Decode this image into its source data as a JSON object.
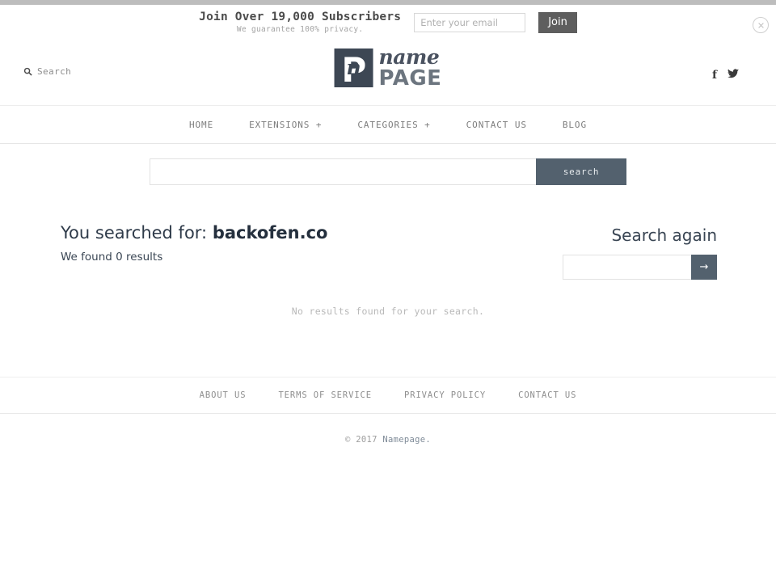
{
  "colors": {
    "accent_slate": "#53616e",
    "logo_dark": "#3d4754",
    "join_button": "#5e5e5e",
    "top_strip": "#bdbdbd",
    "heading_navy": "#2f3b4a",
    "muted_gray": "#b9b9b9"
  },
  "optin": {
    "title": "Join Over 19,000 Subscribers",
    "subtitle": "We guarantee 100% privacy.",
    "email_placeholder": "Enter your email",
    "email_value": "",
    "join_label": "Join",
    "close_icon": "close-circle-icon"
  },
  "header": {
    "search_label": "Search",
    "search_icon": "magnifier-icon",
    "logo": {
      "mark_letter": "P",
      "mark_script": "n",
      "word_top": "name",
      "word_bottom": "PAGE"
    },
    "socials": [
      {
        "name": "facebook",
        "icon": "facebook-icon",
        "glyph": "f"
      },
      {
        "name": "twitter",
        "icon": "twitter-bird-icon",
        "glyph": ""
      }
    ]
  },
  "mainnav": {
    "items": [
      {
        "label": "HOME"
      },
      {
        "label": "EXTENSIONS +"
      },
      {
        "label": "CATEGORIES +"
      },
      {
        "label": "CONTACT US"
      },
      {
        "label": "BLOG"
      }
    ]
  },
  "search_bar": {
    "input_value": "",
    "input_placeholder": "",
    "button_label": "search"
  },
  "results": {
    "heading_prefix": "You searched for: ",
    "query": "backofen.co",
    "count_text": "We found 0 results",
    "empty_message": "No results found for your search.",
    "again_title": "Search again",
    "again_input_value": "",
    "again_input_placeholder": "",
    "again_button_label": "→"
  },
  "footer": {
    "links": [
      {
        "label": "ABOUT US"
      },
      {
        "label": "TERMS OF SERVICE"
      },
      {
        "label": "PRIVACY POLICY"
      },
      {
        "label": "CONTACT US"
      }
    ],
    "copyright_year": "© 2017 ",
    "copyright_name": "Namepage."
  }
}
